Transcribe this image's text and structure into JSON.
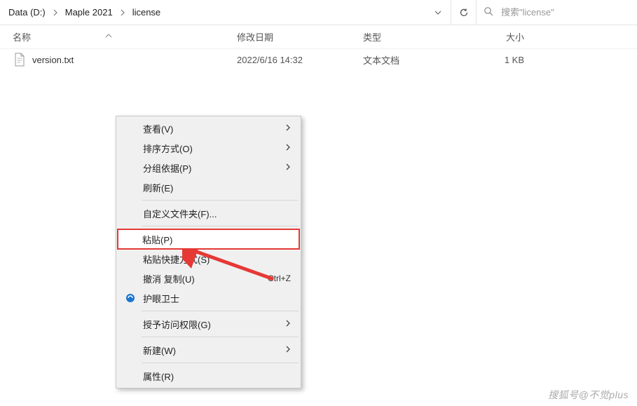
{
  "breadcrumbs": {
    "items": [
      "Data (D:)",
      "Maple 2021",
      "license"
    ]
  },
  "search": {
    "placeholder": "搜索\"license\""
  },
  "columns": {
    "name": "名称",
    "date": "修改日期",
    "type": "类型",
    "size": "大小"
  },
  "files": [
    {
      "name": "version.txt",
      "date": "2022/6/16 14:32",
      "type": "文本文档",
      "size": "1 KB"
    }
  ],
  "context_menu": {
    "view": "查看(V)",
    "sort": "排序方式(O)",
    "group": "分组依据(P)",
    "refresh": "刷新(E)",
    "customize": "自定义文件夹(F)...",
    "paste": "粘贴(P)",
    "paste_shortcut": "粘贴快捷方式(S)",
    "undo": "撤消 复制(U)",
    "undo_key": "Ctrl+Z",
    "eye_guard": "护眼卫士",
    "grant_access": "授予访问权限(G)",
    "new": "新建(W)",
    "properties": "属性(R)"
  },
  "watermark": "搜狐号@不觉plus"
}
